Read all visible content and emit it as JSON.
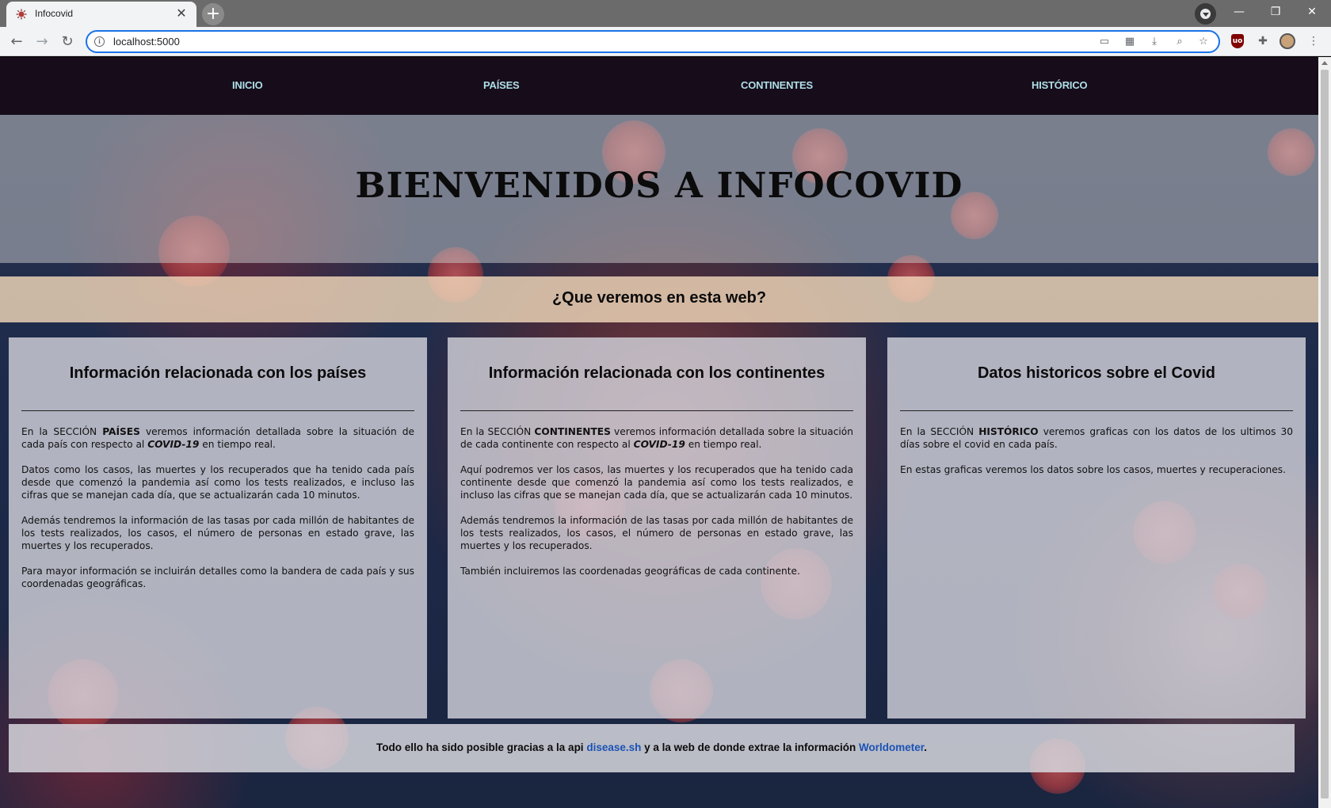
{
  "browser": {
    "tab_title": "Infocovid",
    "url": "localhost:5000"
  },
  "nav": {
    "items": [
      {
        "label": "INICIO"
      },
      {
        "label": "PAÍSES"
      },
      {
        "label": "CONTINENTES"
      },
      {
        "label": "HISTÓRICO"
      }
    ],
    "link_color": "#aedfe7"
  },
  "hero": {
    "title": "BIENVENIDOS A INFOCOVID"
  },
  "subheading": "¿Que veremos en esta web?",
  "cards": [
    {
      "title": "Información relacionada con los países",
      "paragraphs": [
        {
          "a": "En la SECCIÓN ",
          "b": "PAÍSES",
          "c": " veremos información detallada sobre la situación de cada país con respecto al ",
          "d": "COVID-19",
          "e": " en tiempo real."
        },
        {
          "text": "Datos como los casos, las muertes y los recuperados que ha tenido cada país desde que comenzó la pandemia así como los tests realizados, e incluso las cifras que se manejan cada día, que se actualizarán cada 10 minutos."
        },
        {
          "text": "Además tendremos la información de las tasas por cada millón de habitantes de los tests realizados, los casos, el número de personas en estado grave, las muertes y los recuperados."
        },
        {
          "text": "Para mayor información se incluirán detalles como la bandera de cada país y sus coordenadas geográficas."
        }
      ]
    },
    {
      "title": "Información relacionada con los continentes",
      "paragraphs": [
        {
          "a": "En la SECCIÓN ",
          "b": "CONTINENTES",
          "c": " veremos información detallada sobre la situación de cada continente con respecto al ",
          "d": "COVID-19",
          "e": " en tiempo real."
        },
        {
          "text": "Aquí podremos ver los casos, las muertes y los recuperados que ha tenido cada continente desde que comenzó la pandemia así como los tests realizados, e incluso las cifras que se manejan cada día, que se actualizarán cada 10 minutos."
        },
        {
          "text": "Además tendremos la información de las tasas por cada millón de habitantes de los tests realizados, los casos, el número de personas en estado grave, las muertes y los recuperados."
        },
        {
          "text": "También incluiremos las coordenadas geográficas de cada continente."
        }
      ]
    },
    {
      "title": "Datos historicos sobre el Covid",
      "paragraphs": [
        {
          "a": "En la SECCIÓN ",
          "b": "HISTÓRICO",
          "c": " veremos graficas con los datos de los ultimos 30 días sobre el covid en cada país."
        },
        {
          "text": "En estas graficas veremos los datos sobre los casos, muertes y recuperaciones."
        }
      ]
    }
  ],
  "footer": {
    "before": "Todo ello ha sido posible gracias a la api ",
    "link1": "disease.sh",
    "middle": " y a la web de donde extrae la información ",
    "link2": "Worldometer",
    "after": ".",
    "link_color": "#1b53b5"
  }
}
